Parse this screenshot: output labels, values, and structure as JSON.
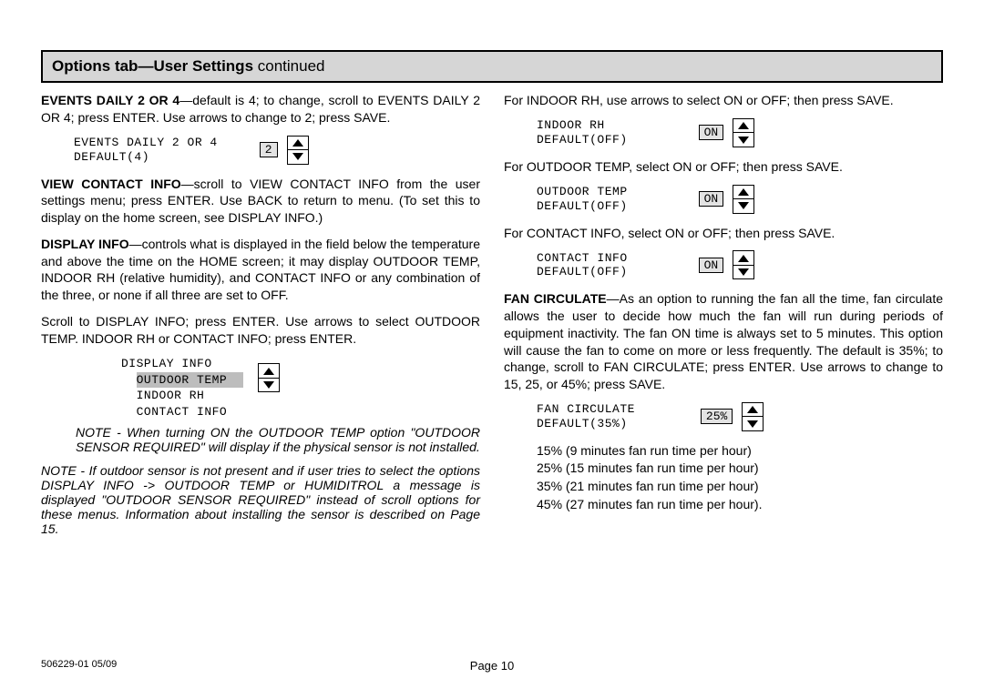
{
  "header": {
    "title_bold": "Options tab—User Settings",
    "title_rest": " continued"
  },
  "left": {
    "p1_lead": "EVENTS DAILY 2 OR 4",
    "p1_rest": "—default is 4; to change, scroll to EVENTS DAILY 2 OR 4; press ENTER. Use arrows to change to 2; press SAVE.",
    "lcd1_line1": "EVENTS DAILY 2 OR 4",
    "lcd1_line2": "DEFAULT(4)",
    "lcd1_value": "2",
    "p2_lead": "VIEW CONTACT INFO",
    "p2_rest": "—scroll to VIEW CONTACT INFO from the user settings menu; press ENTER. Use BACK to return to menu. (To set this to display on the home screen, see DISPLAY INFO.)",
    "p3_lead": "DISPLAY INFO",
    "p3_rest": "—controls what is displayed in the field below the temperature and above the time on the HOME screen; it may display OUTDOOR TEMP, INDOOR RH (relative humidity), and CONTACT INFO or any combination of the three, or none if all three are set to OFF.",
    "p4": "Scroll to DISPLAY INFO; press ENTER. Use arrows to select OUTDOOR TEMP. INDOOR RH or CONTACT INFO; press ENTER.",
    "lcd_list_l1": "DISPLAY INFO",
    "lcd_list_l2": "OUTDOOR TEMP",
    "lcd_list_l3": "INDOOR RH",
    "lcd_list_l4": "CONTACT INFO",
    "note1": "NOTE - When turning ON the OUTDOOR TEMP option \"OUTDOOR SENSOR REQUIRED\" will display if the physical sensor is not installed.",
    "note2": "NOTE - If outdoor sensor is not present and if user tries to select the options DISPLAY INFO -> OUTDOOR TEMP or  HUMIDITROL a message is displayed \"OUTDOOR SENSOR REQUIRED\" instead of scroll options for these menus. Information about installing the sensor is described on Page 15."
  },
  "right": {
    "p1": "For INDOOR RH, use arrows to select ON or OFF; then press SAVE.",
    "lcd_rh_l1": "INDOOR RH",
    "lcd_rh_l2": "DEFAULT(OFF)",
    "lcd_rh_val": "ON",
    "p2": "For OUTDOOR TEMP, select ON or OFF; then press SAVE.",
    "lcd_ot_l1": "OUTDOOR TEMP",
    "lcd_ot_l2": "DEFAULT(OFF)",
    "lcd_ot_val": "ON",
    "p3": "For CONTACT INFO, select ON or OFF; then press SAVE.",
    "lcd_ci_l1": "CONTACT INFO",
    "lcd_ci_l2": "DEFAULT(OFF)",
    "lcd_ci_val": "ON",
    "p4_lead": "FAN CIRCULATE",
    "p4_rest": "—As an option to running the fan all the time, fan circulate allows the user to decide how much the fan will run during periods of equipment inactivity. The fan ON time is always set to 5 minutes. This option will cause the fan to come on more or less frequently. The default is 35%; to change, scroll to FAN CIRCULATE; press ENTER. Use arrows to change to 15, 25, or 45%; press SAVE.",
    "lcd_fc_l1": "FAN CIRCULATE",
    "lcd_fc_l2": "DEFAULT(35%)",
    "lcd_fc_val": "25%",
    "list1": "15% (9 minutes fan run time per hour)",
    "list2": "25% (15 minutes fan run time per hour)",
    "list3": "35% (21 minutes fan run time per hour)",
    "list4": "45% (27 minutes fan run time per hour)."
  },
  "footer": {
    "left": "506229-01 05/09",
    "center": "Page 10"
  }
}
